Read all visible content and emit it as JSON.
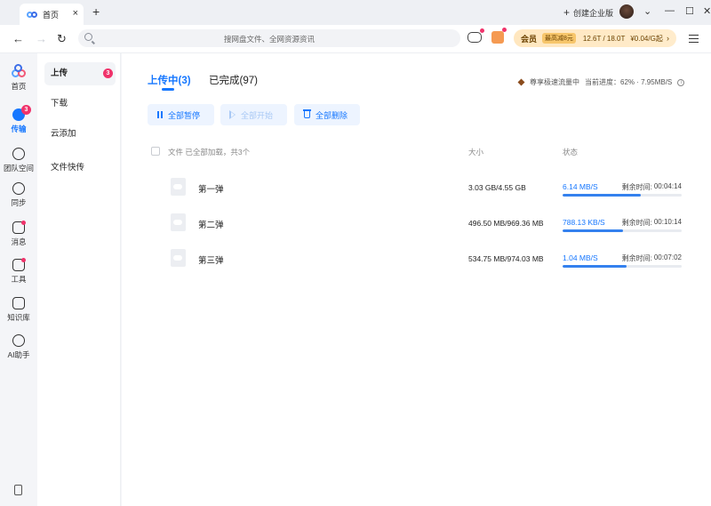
{
  "titlebar": {
    "tab_title": "首页",
    "enterprise_label": "创建企业版"
  },
  "toolbar": {
    "search_placeholder": "搜网盘文件、全网资源资讯",
    "vip_label": "会员",
    "vip_offer": "最高减8元",
    "storage": "12.6T / 18.0T",
    "price": "¥0.04/G起"
  },
  "rail": {
    "items": [
      {
        "label": "首页",
        "icon": "home-icon"
      },
      {
        "label": "传输",
        "icon": "transfer-icon",
        "badge": "3",
        "active": true
      },
      {
        "label": "团队空间",
        "icon": "team-icon"
      },
      {
        "label": "同步",
        "icon": "sync-icon"
      },
      {
        "label": "消息",
        "icon": "message-icon"
      },
      {
        "label": "工具",
        "icon": "tools-icon"
      },
      {
        "label": "知识库",
        "icon": "knowledge-icon"
      },
      {
        "label": "AI助手",
        "icon": "ai-icon"
      }
    ]
  },
  "subnav": {
    "items": [
      {
        "label": "上传",
        "badge": "3",
        "active": true
      },
      {
        "label": "下载"
      },
      {
        "label": "云添加"
      },
      {
        "label": "文件快传"
      }
    ]
  },
  "main": {
    "tabs": [
      {
        "label": "上传中(3)",
        "active": true
      },
      {
        "label": "已完成(97)"
      }
    ],
    "speed_tag": "尊享极速流量中",
    "progress_text": "当前进度：62% · 7.95MB/S",
    "actions": {
      "pause_all": "全部暂停",
      "start_all": "全部开始",
      "delete_all": "全部删除"
    },
    "columns": {
      "file": "文件 已全部加载，共3个",
      "size": "大小",
      "status": "状态"
    },
    "remain_label": "剩余时间:",
    "rows": [
      {
        "name": "第一弹",
        "size": "3.03 GB/4.55 GB",
        "speed": "6.14 MB/S",
        "remain": "00:04:14",
        "progress": 0.66
      },
      {
        "name": "第二弹",
        "size": "496.50 MB/969.36 MB",
        "speed": "788.13 KB/S",
        "remain": "00:10:14",
        "progress": 0.51
      },
      {
        "name": "第三弹",
        "size": "534.75 MB/974.03 MB",
        "speed": "1.04 MB/S",
        "remain": "00:07:02",
        "progress": 0.54
      }
    ]
  }
}
